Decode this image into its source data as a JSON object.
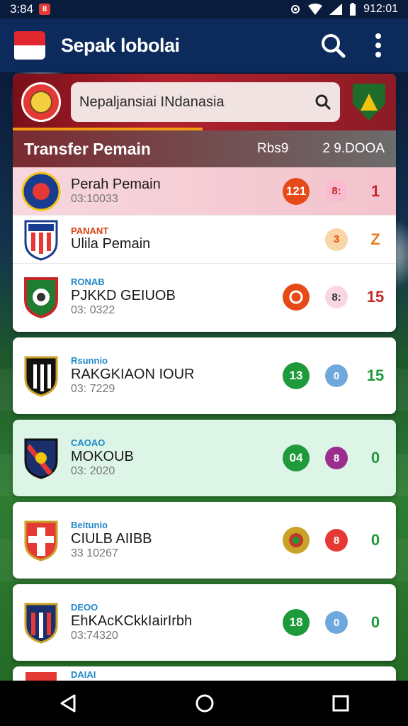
{
  "status": {
    "time": "3:84",
    "notif": "8",
    "right": "912:01"
  },
  "app": {
    "title": "Sepak lobolai"
  },
  "search": {
    "placeholder": "Nepaljansiai INdanasia"
  },
  "section": {
    "title": "Transfer Pemain",
    "mid": "Rbs9",
    "right": "2 9.DOOA"
  },
  "rows": [
    {
      "cat": "",
      "name": "Perah Pemain",
      "code": "03:10033",
      "badge1": "121",
      "badge2": "8:",
      "value": "1",
      "b1color": "#e64a19",
      "b2color": "#f8bbd0",
      "b2text": "#c62828",
      "valcolor": "#c62828"
    },
    {
      "cat": "PANANT",
      "name": "Ulila Pemain",
      "code": "",
      "badge1": "",
      "badge2": "3",
      "value": "Z",
      "b2color": "#f9d5a7",
      "b2text": "#e65100",
      "valcolor": "#e67e22"
    },
    {
      "cat": "RONAB",
      "name": "PJKKD GEIUOB",
      "code": "03: 0322",
      "badge1": "",
      "badge2": "8:",
      "value": "15",
      "b1color": "#e64a19",
      "b2color": "#f8d7e0",
      "b2text": "#333",
      "valcolor": "#c62828"
    }
  ],
  "items": [
    {
      "cat": "Rsunnio",
      "name": "RAKGKIAON IOUR",
      "code": "03: 7229",
      "badge1": "13",
      "badge2": "0",
      "value": "15",
      "b1color": "#1e9a3a",
      "b2color": "#6fa8dc",
      "valcolor": "#1e9a3a"
    },
    {
      "cat": "CAOAO",
      "name": "MOKOUB",
      "code": "03: 2020",
      "badge1": "04",
      "badge2": "8",
      "value": "0",
      "b1color": "#1e9a3a",
      "b2color": "#9b2d8f",
      "valcolor": "#1e9a3a"
    },
    {
      "cat": "Beitunio",
      "name": "CIULB AIIBB",
      "code": "33 10267",
      "badge1": "",
      "badge2": "8",
      "value": "0",
      "b1color": "#c0392b",
      "b2color": "#e53935",
      "valcolor": "#1e9a3a"
    },
    {
      "cat": "DEOO",
      "name": "EhKAcKCkkIairIrbh",
      "code": "03:74320",
      "badge1": "18",
      "badge2": "0",
      "value": "0",
      "b1color": "#1e9a3a",
      "b2color": "#6fa8dc",
      "valcolor": "#1e9a3a"
    },
    {
      "cat": "DAIAI",
      "name": "",
      "code": "",
      "badge1": "",
      "badge2": "",
      "value": "",
      "b1color": "#1e9a3a",
      "b2color": "#1e9a3a",
      "valcolor": "#1e9a3a"
    }
  ]
}
